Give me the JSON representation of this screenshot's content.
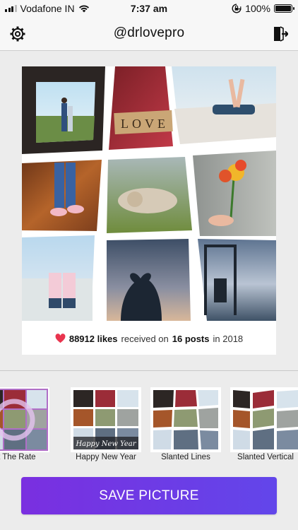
{
  "status_bar": {
    "carrier": "Vodafone IN",
    "time": "7:37 am",
    "battery_percent": "100%",
    "battery_level": 1.0,
    "icons": [
      "signal-icon",
      "wifi-icon",
      "orientation-lock-icon",
      "battery-icon"
    ]
  },
  "nav": {
    "title": "@drlovepro",
    "left_icon": "settings-gear-icon",
    "right_icon": "logout-icon"
  },
  "collage": {
    "tile_text": "LOVE",
    "caption": {
      "likes_count": "88912 likes",
      "received_on": "received on",
      "posts_count": "16 posts",
      "year_text": "in 2018",
      "heart_color": "#e9344e"
    }
  },
  "templates": [
    {
      "label": "At The Rate"
    },
    {
      "label": "Happy New Year",
      "overlay_text": "Happy New Year"
    },
    {
      "label": "Slanted Lines"
    },
    {
      "label": "Slanted Vertical"
    }
  ],
  "save_button": {
    "label": "SAVE PICTURE"
  },
  "colors": {
    "accent_start": "#7a2fe0",
    "accent_end": "#6246ea",
    "background": "#ececec"
  }
}
